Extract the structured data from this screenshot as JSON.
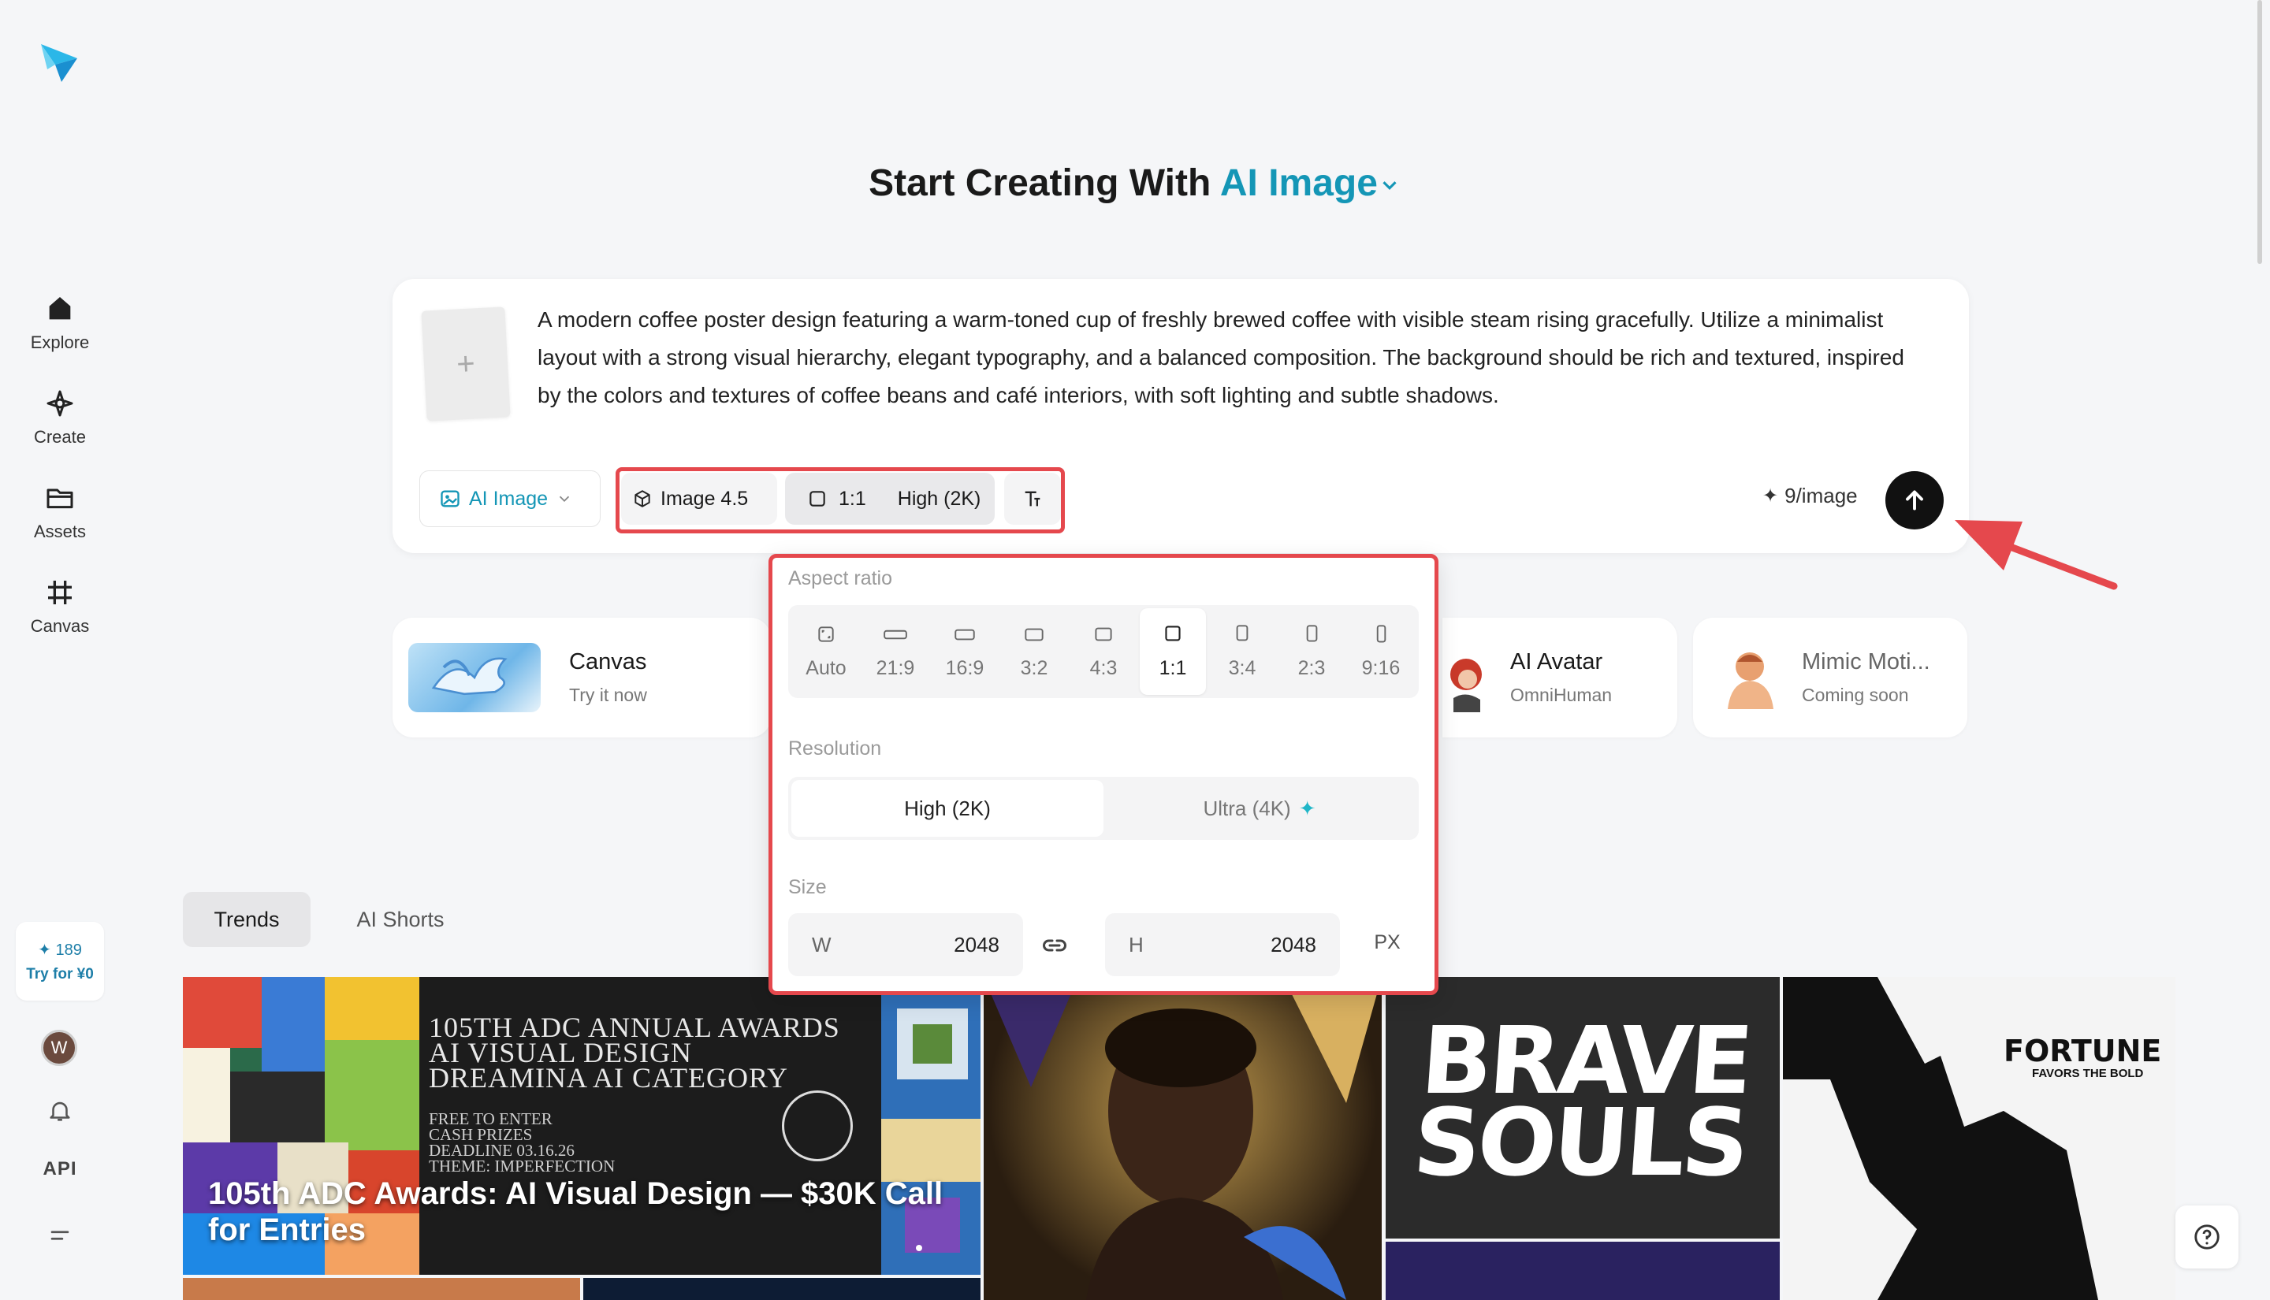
{
  "sidebar": {
    "items": [
      {
        "label": "Explore"
      },
      {
        "label": "Create"
      },
      {
        "label": "Assets"
      },
      {
        "label": "Canvas"
      }
    ],
    "credits": {
      "count": "189",
      "cta": "Try for ¥0"
    },
    "avatar_initial": "W",
    "api_label": "API"
  },
  "heading": {
    "prefix": "Start Creating With",
    "accent": "AI Image"
  },
  "prompt": {
    "text": "A modern coffee poster design featuring a warm-toned cup of freshly brewed coffee with visible steam rising gracefully. Utilize a minimalist layout with a strong visual hierarchy, elegant typography, and a balanced composition. The background should be rich and textured, inspired by the colors and textures of coffee beans and café interiors, with soft lighting and subtle shadows.",
    "mode": "AI Image",
    "model": "Image 4.5",
    "ratio": "1:1",
    "quality": "High (2K)",
    "cost": "9/image"
  },
  "features": [
    {
      "title": "Canvas",
      "subtitle": "Try it now"
    },
    {
      "title": "AI Avatar",
      "subtitle": "OmniHuman"
    },
    {
      "title": "Mimic Moti...",
      "subtitle": "Coming soon"
    }
  ],
  "popover": {
    "aspect_label": "Aspect ratio",
    "ratios": [
      "Auto",
      "21:9",
      "16:9",
      "3:2",
      "4:3",
      "1:1",
      "3:4",
      "2:3",
      "9:16"
    ],
    "selected_ratio": "1:1",
    "resolution_label": "Resolution",
    "resolutions": [
      "High (2K)",
      "Ultra (4K)"
    ],
    "size_label": "Size",
    "width_label": "W",
    "width": "2048",
    "height_label": "H",
    "height": "2048",
    "unit": "PX"
  },
  "tabs": [
    {
      "label": "Trends"
    },
    {
      "label": "AI Shorts"
    }
  ],
  "gallery": {
    "featured_title": "105th ADC Awards: AI Visual Design — $30K Call for Entries",
    "poster_lines": [
      "105TH ADC ANNUAL AWARDS",
      "AI VISUAL DESIGN",
      "DREAMINA AI CATEGORY"
    ],
    "poster_small": [
      "FREE TO ENTER",
      "CASH PRIZES",
      "DEADLINE 03.16.26",
      "THEME: IMPERFECTION"
    ],
    "brave_title": "BRAVE SOULS",
    "fortune_title": "FORTUNE",
    "fortune_sub": "FAVORS THE BOLD"
  },
  "colors": {
    "accent": "#1496b6",
    "highlight": "#e5484d",
    "background": "#f5f6f8"
  }
}
